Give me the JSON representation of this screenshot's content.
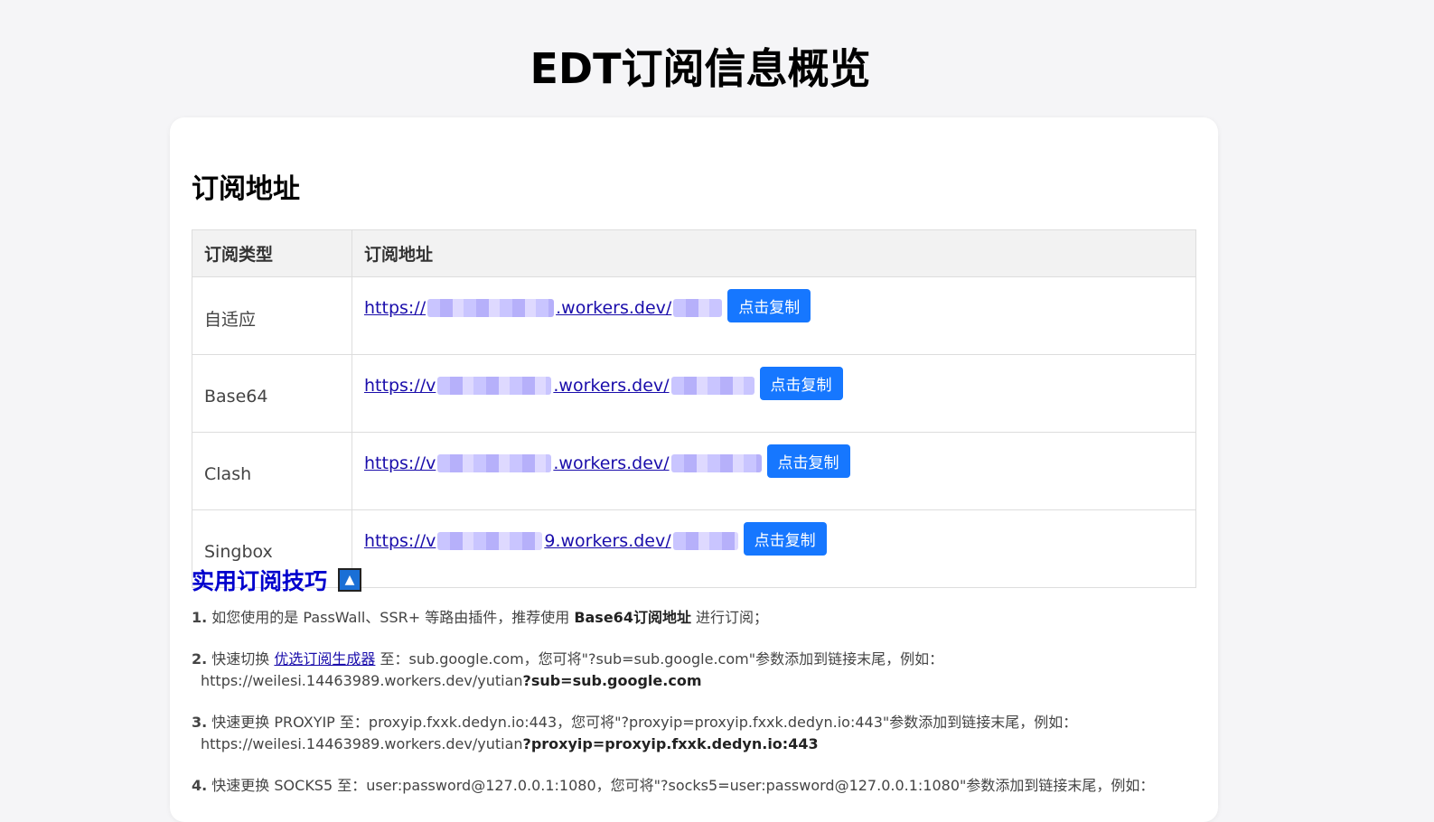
{
  "page": {
    "title": "EDT订阅信息概览"
  },
  "subscriptions": {
    "title": "订阅地址",
    "headers": {
      "type": "订阅类型",
      "url": "订阅地址"
    },
    "copy_label": "点击复制",
    "rows": [
      {
        "type": "自适应",
        "prefix": "https://",
        "middle": ".workers.dev/"
      },
      {
        "type": "Base64",
        "prefix": "https://v",
        "middle": ".workers.dev/"
      },
      {
        "type": "Clash",
        "prefix": "https://v",
        "middle": ".workers.dev/"
      },
      {
        "type": "Singbox",
        "prefix": "https://v",
        "middle": "9.workers.dev/"
      }
    ]
  },
  "tips": {
    "title": "实用订阅技巧",
    "toggle_icon": "▲",
    "items": [
      {
        "num": "1.",
        "pre": " 如您使用的是 PassWall、SSR+ 等路由插件，推荐使用 ",
        "bold": "Base64订阅地址",
        "post": " 进行订阅；"
      },
      {
        "num": "2.",
        "pre": " 快速切换 ",
        "link": "优选订阅生成器",
        "post": " 至：sub.google.com，您可将\"?sub=sub.google.com\"参数添加到链接末尾，例如：",
        "example": "https://weilesi.14463989.workers.dev/yutian",
        "example_bold": "?sub=sub.google.com"
      },
      {
        "num": "3.",
        "pre": " 快速更换 PROXYIP 至：proxyip.fxxk.dedyn.io:443，您可将\"?proxyip=proxyip.fxxk.dedyn.io:443\"参数添加到链接末尾，例如：",
        "example": "https://weilesi.14463989.workers.dev/yutian",
        "example_bold": "?proxyip=proxyip.fxxk.dedyn.io:443"
      },
      {
        "num": "4.",
        "pre": " 快速更换 SOCKS5 至：user:password@127.0.0.1:1080，您可将\"?socks5=user:password@127.0.0.1:1080\"参数添加到链接末尾，例如："
      }
    ]
  }
}
